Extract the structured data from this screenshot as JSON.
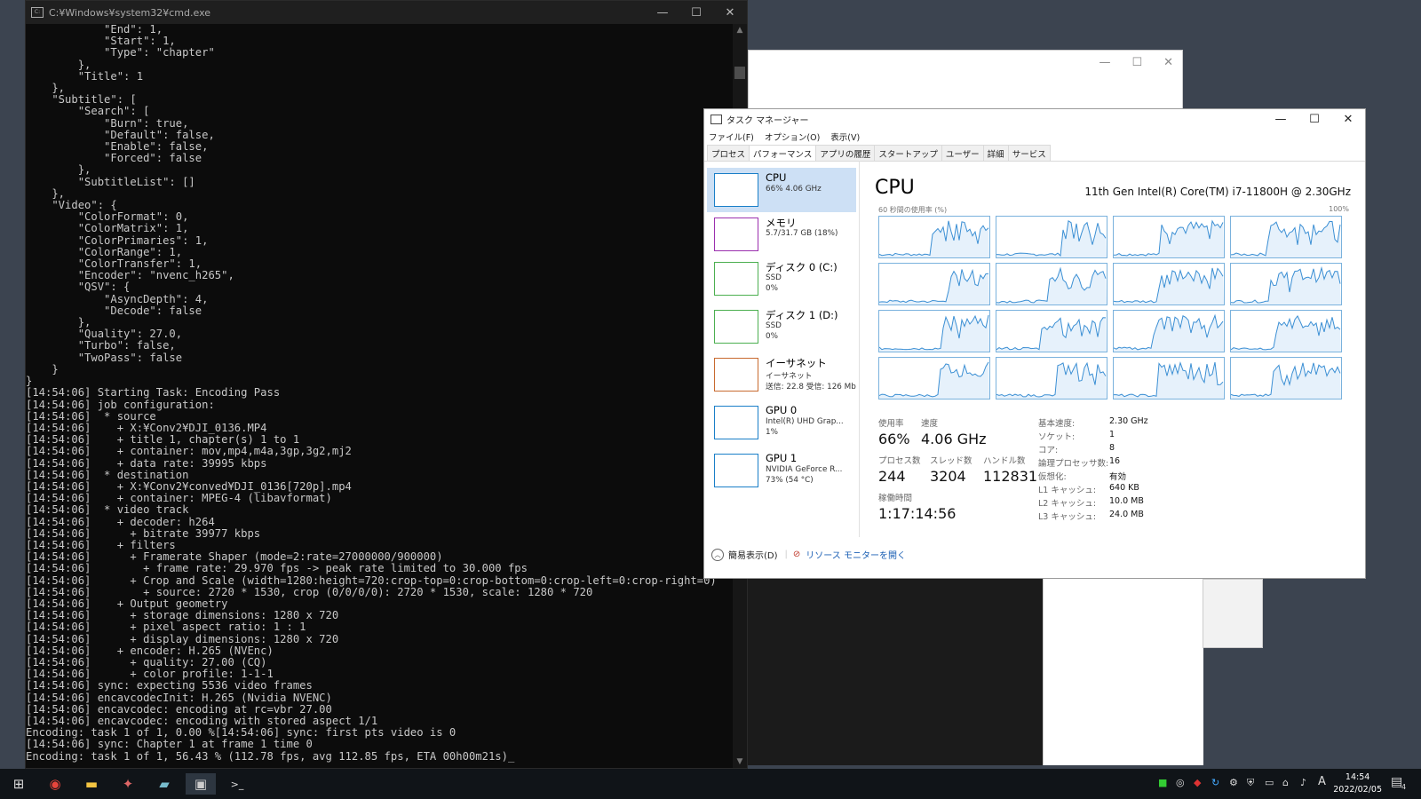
{
  "cmd": {
    "title": "C:¥Windows¥system32¥cmd.exe",
    "lines": [
      "            \"End\": 1,",
      "            \"Start\": 1,",
      "            \"Type\": \"chapter\"",
      "        },",
      "        \"Title\": 1",
      "    },",
      "    \"Subtitle\": [",
      "        \"Search\": [",
      "            \"Burn\": true,",
      "            \"Default\": false,",
      "            \"Enable\": false,",
      "            \"Forced\": false",
      "        },",
      "        \"SubtitleList\": []",
      "    },",
      "    \"Video\": {",
      "        \"ColorFormat\": 0,",
      "        \"ColorMatrix\": 1,",
      "        \"ColorPrimaries\": 1,",
      "        \"ColorRange\": 1,",
      "        \"ColorTransfer\": 1,",
      "        \"Encoder\": \"nvenc_h265\",",
      "        \"QSV\": {",
      "            \"AsyncDepth\": 4,",
      "            \"Decode\": false",
      "        },",
      "        \"Quality\": 27.0,",
      "        \"Turbo\": false,",
      "        \"TwoPass\": false",
      "    }",
      "}",
      "[14:54:06] Starting Task: Encoding Pass",
      "[14:54:06] job configuration:",
      "[14:54:06]  * source",
      "[14:54:06]    + X:¥Conv2¥DJI_0136.MP4",
      "[14:54:06]    + title 1, chapter(s) 1 to 1",
      "[14:54:06]    + container: mov,mp4,m4a,3gp,3g2,mj2",
      "[14:54:06]    + data rate: 39995 kbps",
      "[14:54:06]  * destination",
      "[14:54:06]    + X:¥Conv2¥conved¥DJI_0136[720p].mp4",
      "[14:54:06]    + container: MPEG-4 (libavformat)",
      "[14:54:06]  * video track",
      "[14:54:06]    + decoder: h264",
      "[14:54:06]      + bitrate 39977 kbps",
      "[14:54:06]    + filters",
      "[14:54:06]      + Framerate Shaper (mode=2:rate=27000000/900000)",
      "[14:54:06]        + frame rate: 29.970 fps -> peak rate limited to 30.000 fps",
      "[14:54:06]      + Crop and Scale (width=1280:height=720:crop-top=0:crop-bottom=0:crop-left=0:crop-right=0)",
      "[14:54:06]        + source: 2720 * 1530, crop (0/0/0/0): 2720 * 1530, scale: 1280 * 720",
      "[14:54:06]    + Output geometry",
      "[14:54:06]      + storage dimensions: 1280 x 720",
      "[14:54:06]      + pixel aspect ratio: 1 : 1",
      "[14:54:06]      + display dimensions: 1280 x 720",
      "[14:54:06]    + encoder: H.265 (NVEnc)",
      "[14:54:06]      + quality: 27.00 (CQ)",
      "[14:54:06]      + color profile: 1-1-1",
      "[14:54:06] sync: expecting 5536 video frames",
      "[14:54:06] encavcodecInit: H.265 (Nvidia NVENC)",
      "[14:54:06] encavcodec: encoding at rc=vbr 27.00",
      "[14:54:06] encavcodec: encoding with stored aspect 1/1",
      "Encoding: task 1 of 1, 0.00 %[14:54:06] sync: first pts video is 0",
      "[14:54:06] sync: Chapter 1 at frame 1 time 0",
      "Encoding: task 1 of 1, 56.43 % (112.78 fps, avg 112.85 fps, ETA 00h00m21s)_"
    ]
  },
  "window_controls": {
    "minimize": "—",
    "maximize": "☐",
    "close": "✕"
  },
  "task_manager": {
    "title": "タスク マネージャー",
    "menu": [
      "ファイル(F)",
      "オプション(O)",
      "表示(V)"
    ],
    "tabs": [
      "プロセス",
      "パフォーマンス",
      "アプリの履歴",
      "スタートアップ",
      "ユーザー",
      "詳細",
      "サービス"
    ],
    "active_tab": 1,
    "sidebar": [
      {
        "name": "CPU",
        "l1": "66%  4.06 GHz",
        "l2": "",
        "l3": "",
        "color": "#1a7fc8"
      },
      {
        "name": "メモリ",
        "l1": "5.7/31.7 GB (18%)",
        "l2": "",
        "l3": "",
        "color": "#9b2fae"
      },
      {
        "name": "ディスク 0 (C:)",
        "l1": "SSD",
        "l2": "0%",
        "l3": "",
        "color": "#4caf50"
      },
      {
        "name": "ディスク 1 (D:)",
        "l1": "SSD",
        "l2": "0%",
        "l3": "",
        "color": "#4caf50"
      },
      {
        "name": "イーサネット",
        "l1": "イーサネット",
        "l2": "送信: 22.8  受信: 126 Mb",
        "l3": "",
        "color": "#c86a2f"
      },
      {
        "name": "GPU 0",
        "l1": "Intel(R) UHD Grap...",
        "l2": "1%",
        "l3": "",
        "color": "#1a7fc8"
      },
      {
        "name": "GPU 1",
        "l1": "NVIDIA GeForce R...",
        "l2": "73% (54 °C)",
        "l3": "",
        "color": "#1a7fc8"
      }
    ],
    "main_title": "CPU",
    "cpu_name": "11th Gen Intel(R) Core(TM) i7-11800H @ 2.30GHz",
    "axis_left": "60 秒間の使用率 (%)",
    "axis_right": "100%",
    "stats": {
      "usage_label": "使用率",
      "usage": "66%",
      "speed_label": "速度",
      "speed": "4.06 GHz",
      "proc_label": "プロセス数",
      "proc": "244",
      "thread_label": "スレッド数",
      "thread": "3204",
      "handle_label": "ハンドル数",
      "handle": "112831",
      "uptime_label": "稼働時間",
      "uptime": "1:17:14:56"
    },
    "specs": [
      {
        "k": "基本速度:",
        "v": "2.30 GHz"
      },
      {
        "k": "ソケット:",
        "v": "1"
      },
      {
        "k": "コア:",
        "v": "8"
      },
      {
        "k": "論理プロセッサ数:",
        "v": "16"
      },
      {
        "k": "仮想化:",
        "v": "有効"
      },
      {
        "k": "L1 キャッシュ:",
        "v": "640 KB"
      },
      {
        "k": "L2 キャッシュ:",
        "v": "10.0 MB"
      },
      {
        "k": "L3 キャッシュ:",
        "v": "24.0 MB"
      }
    ],
    "bottom_simple": "簡易表示(D)",
    "bottom_link": "リソース モニターを開く"
  },
  "taskbar": {
    "icons": [
      "windows-start-icon",
      "chrome-icon",
      "file-explorer-icon",
      "app-icon",
      "notepad-icon",
      "handbrake-icon",
      "cmd-icon"
    ],
    "ime": "A",
    "time": "14:54",
    "date": "2022/02/05",
    "notif_count": "4"
  }
}
